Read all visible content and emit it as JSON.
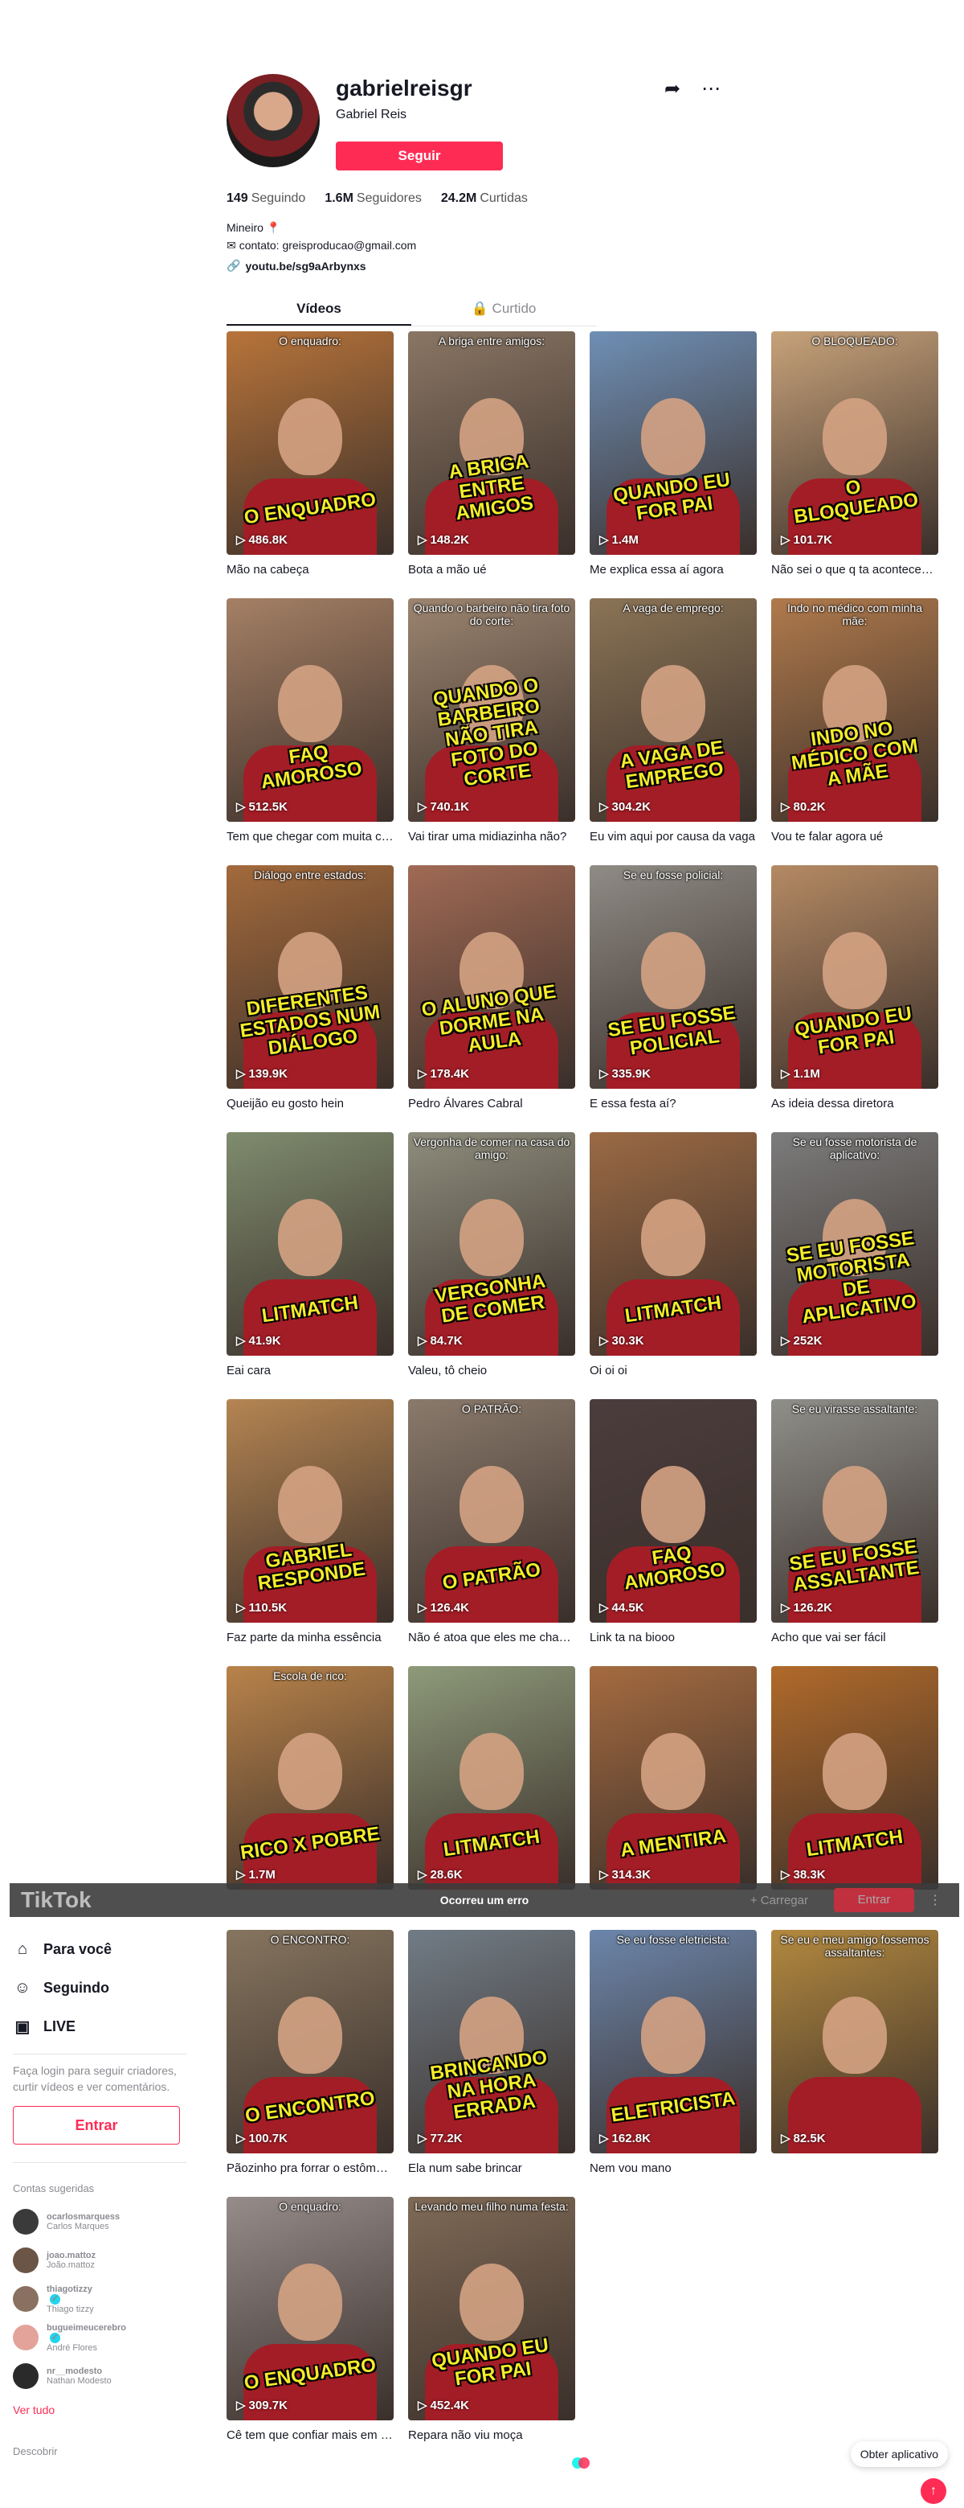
{
  "profile": {
    "username": "gabrielreisgr",
    "nickname": "Gabriel Reis",
    "follow_label": "Seguir",
    "stats": [
      {
        "value": "149",
        "label": "Seguindo"
      },
      {
        "value": "1.6M",
        "label": "Seguidores"
      },
      {
        "value": "24.2M",
        "label": "Curtidas"
      }
    ],
    "bio_line1": "Mineiro",
    "bio_line2": "contato: greisproducao@gmail.com",
    "link": "youtu.be/sg9aArbynxs"
  },
  "tabs": {
    "videos": "Vídeos",
    "liked": "Curtido"
  },
  "videos": [
    {
      "views": "486.8K",
      "desc": "Mão na cabeça",
      "top": "O enquadro:",
      "caption": "O ENQUADRO",
      "bg": "#b8743a"
    },
    {
      "views": "148.2K",
      "desc": "Bota a mão ué",
      "top": "A briga entre amigos:",
      "caption": "A BRIGA ENTRE AMIGOS",
      "bg": "#8a7664"
    },
    {
      "views": "1.4M",
      "desc": "Me explica essa aí agora",
      "top": "",
      "caption": "QUANDO EU FOR PAI",
      "bg": "#6f8fb5"
    },
    {
      "views": "101.7K",
      "desc": "Não sei o que q ta acontecendo",
      "top": "O BLOQUEADO:",
      "caption": "O BLOQUEADO",
      "bg": "#c7a27a"
    },
    {
      "views": "512.5K",
      "desc": "Tem que chegar com muita calma",
      "top": "",
      "caption": "FAQ AMOROSO",
      "bg": "#a58065"
    },
    {
      "views": "740.1K",
      "desc": "Vai tirar uma midiazinha não?",
      "top": "Quando o barbeiro não tira foto do corte:",
      "caption": "QUANDO O BARBEIRO NÃO TIRA FOTO DO CORTE",
      "bg": "#9c8570"
    },
    {
      "views": "304.2K",
      "desc": "Eu vim aqui por causa da vaga",
      "top": "A vaga de emprego:",
      "caption": "A VAGA DE EMPREGO",
      "bg": "#8b7456"
    },
    {
      "views": "80.2K",
      "desc": "Vou te falar agora ué",
      "top": "Indo no médico com minha mãe:",
      "caption": "INDO NO MÉDICO COM A MÃE",
      "bg": "#b07a4c"
    },
    {
      "views": "139.9K",
      "desc": "Queijão eu gosto hein",
      "top": "Diálogo entre estados:",
      "caption": "DIFERENTES ESTADOS NUM DIÁLOGO",
      "bg": "#a36a3c"
    },
    {
      "views": "178.4K",
      "desc": "Pedro Álvares Cabral",
      "top": "",
      "caption": "O ALUNO QUE DORME NA AULA",
      "bg": "#a06a55"
    },
    {
      "views": "335.9K",
      "desc": "E essa festa aí?",
      "top": "Se eu fosse policial:",
      "caption": "SE EU FOSSE POLICIAL",
      "bg": "#8f8b85"
    },
    {
      "views": "1.1M",
      "desc": "As ideia dessa diretora",
      "top": "",
      "caption": "QUANDO EU FOR PAI",
      "bg": "#b58a64"
    },
    {
      "views": "41.9K",
      "desc": "Eai cara",
      "top": "",
      "caption": "LITMATCH",
      "bg": "#7f8c6e"
    },
    {
      "views": "84.7K",
      "desc": "Valeu, tô cheio",
      "top": "Vergonha de comer na casa do amigo:",
      "caption": "VERGONHA DE COMER",
      "bg": "#8e8d7d"
    },
    {
      "views": "30.3K",
      "desc": "Oi oi oi",
      "top": "",
      "caption": "LITMATCH",
      "bg": "#9b6a44"
    },
    {
      "views": "252K",
      "desc": "",
      "top": "Se eu fosse motorista de aplicativo:",
      "caption": "SE EU FOSSE MOTORISTA DE APLICATIVO",
      "bg": "#7c7c7c"
    },
    {
      "views": "110.5K",
      "desc": "Faz parte da minha essência",
      "top": "",
      "caption": "GABRIEL RESPONDE",
      "bg": "#b58552"
    },
    {
      "views": "126.4K",
      "desc": "Não é atoa que eles me chamam",
      "top": "O PATRÃO:",
      "caption": "O PATRÃO",
      "bg": "#8a7a6c"
    },
    {
      "views": "44.5K",
      "desc": "Link ta na biooo",
      "top": "",
      "caption": "FAQ AMOROSO",
      "bg": "#4b3d3d"
    },
    {
      "views": "126.2K",
      "desc": "Acho que vai ser fácil",
      "top": "Se eu virasse assaltante:",
      "caption": "SE EU FOSSE ASSALTANTE",
      "bg": "#8f8f8a"
    },
    {
      "views": "1.7M",
      "desc": "",
      "top": "Escola de rico:",
      "caption": "RICO X POBRE",
      "bg": "#b9834a"
    },
    {
      "views": "28.6K",
      "desc": "",
      "top": "",
      "caption": "LITMATCH",
      "bg": "#8e9a7a"
    },
    {
      "views": "314.3K",
      "desc": "",
      "top": "",
      "caption": "A MENTIRA",
      "bg": "#a56b40"
    },
    {
      "views": "38.3K",
      "desc": "",
      "top": "",
      "caption": "LITMATCH",
      "bg": "#b16a2a"
    },
    {
      "views": "100.7K",
      "desc": "Pãozinho pra forrar o estômago",
      "top": "O ENCONTRO:",
      "caption": "O ENCONTRO",
      "bg": "#86755f"
    },
    {
      "views": "77.2K",
      "desc": "Ela num sabe brincar",
      "top": "",
      "caption": "BRINCANDO NA HORA ERRADA",
      "bg": "#717c86"
    },
    {
      "views": "162.8K",
      "desc": "Nem vou mano",
      "top": "Se eu fosse eletricista:",
      "caption": "ELETRICISTA",
      "bg": "#6c86ab"
    },
    {
      "views": "82.5K",
      "desc": "",
      "top": "Se eu e meu amigo fossemos assaltantes:",
      "caption": "",
      "bg": "#b3893f"
    },
    {
      "views": "309.7K",
      "desc": "Cê tem que confiar mais em mim",
      "top": "O enquadro:",
      "caption": "O ENQUADRO",
      "bg": "#968c8a"
    },
    {
      "views": "452.4K",
      "desc": "Repara não viu moça",
      "top": "Levando meu filho numa festa:",
      "caption": "QUANDO EU FOR PAI",
      "bg": "#7f6a56"
    }
  ],
  "topbar": {
    "logo": "TikTok",
    "error": "Ocorreu um erro",
    "upload": "+ Carregar",
    "login": "Entrar"
  },
  "sidebar": {
    "nav": [
      {
        "icon": "home-icon",
        "label": "Para você"
      },
      {
        "icon": "people-icon",
        "label": "Seguindo"
      },
      {
        "icon": "live-icon",
        "label": "LIVE"
      }
    ],
    "login_prompt": "Faça login para seguir criadores, curtir vídeos e ver comentários.",
    "login_button": "Entrar",
    "suggested_title": "Contas sugeridas",
    "accounts": [
      {
        "handle": "ocarlosmarquess",
        "name": "Carlos Marques",
        "verified": false
      },
      {
        "handle": "joao.mattoz",
        "name": "João.mattoz",
        "verified": false
      },
      {
        "handle": "thiagotizzy",
        "name": "Thiago tizzy",
        "verified": true
      },
      {
        "handle": "bugueimeucerebro",
        "name": "André Flores",
        "verified": true
      },
      {
        "handle": "nr__modesto",
        "name": "Nathan Modesto",
        "verified": false
      }
    ],
    "see_all": "Ver tudo",
    "discover": "Descobrir"
  },
  "get_app": "Obter aplicativo",
  "colors": {
    "brand": "#fe2c55",
    "caption": "#f4ec2a",
    "verified": "#20d5ec"
  }
}
